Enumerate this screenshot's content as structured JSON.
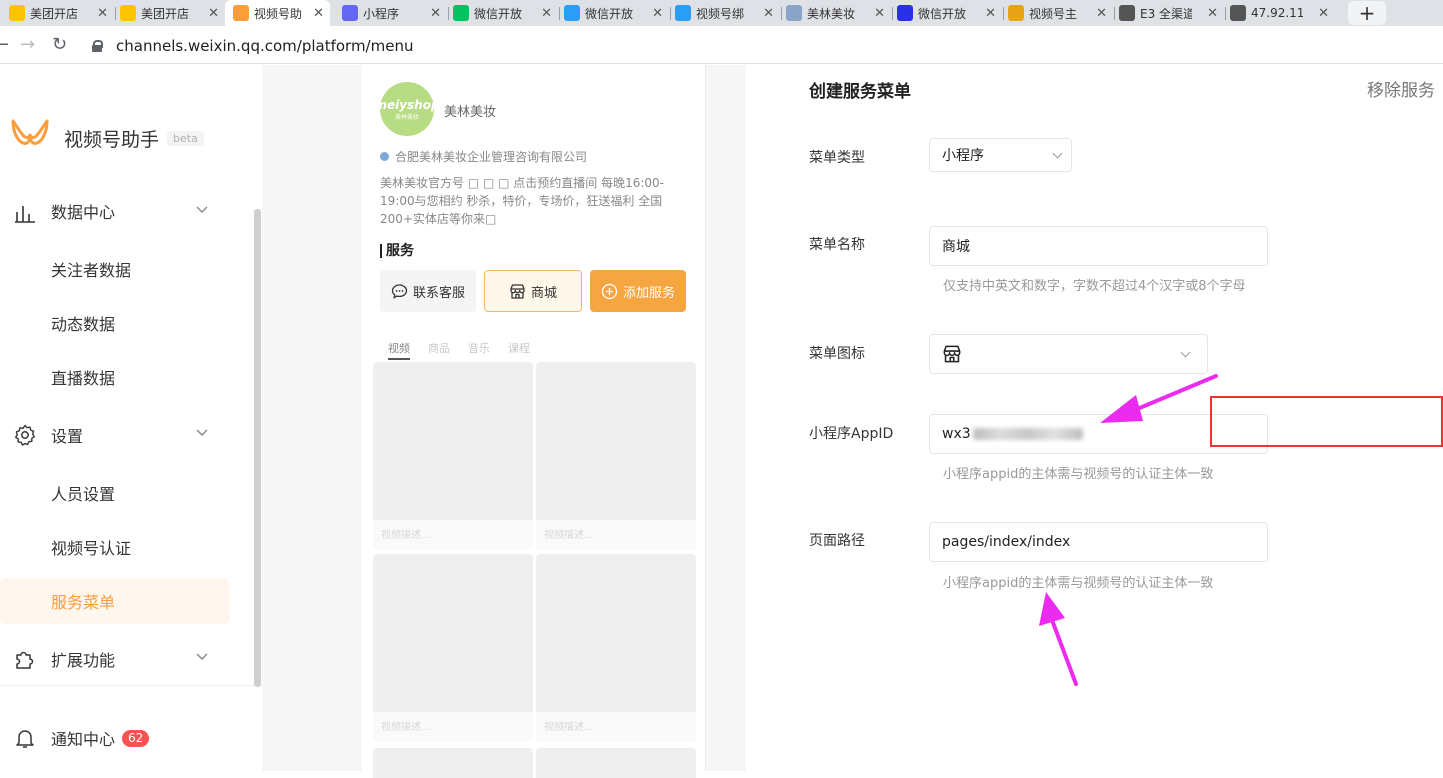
{
  "browser": {
    "tabs": [
      {
        "label": "美团开店",
        "icon": "meituan-icon",
        "color": "#ffc300"
      },
      {
        "label": "美团开店",
        "icon": "meituan-icon",
        "color": "#ffc300"
      },
      {
        "label": "视频号助",
        "icon": "channels-icon",
        "color": "#fa9d3b",
        "active": true
      },
      {
        "label": "小程序",
        "icon": "miniprogram-icon",
        "color": "#6467f0"
      },
      {
        "label": "微信开放",
        "icon": "wechat-icon",
        "color": "#07c160"
      },
      {
        "label": "微信开放",
        "icon": "grid-icon",
        "color": "#2a9df4"
      },
      {
        "label": "视频号绑",
        "icon": "grid-icon",
        "color": "#2a9df4"
      },
      {
        "label": "美林美妆",
        "icon": "doc-icon",
        "color": "#8aa4c8"
      },
      {
        "label": "微信开放",
        "icon": "baidu-icon",
        "color": "#2932e1"
      },
      {
        "label": "视频号主",
        "icon": "s-icon",
        "color": "#e8a317"
      },
      {
        "label": "E3 全渠道",
        "icon": "globe-icon",
        "color": "#555555"
      },
      {
        "label": "47.92.11",
        "icon": "globe-icon",
        "color": "#555555"
      }
    ],
    "url": "channels.weixin.qq.com/platform/menu"
  },
  "sidebar": {
    "brand": "视频号助手",
    "beta": "beta",
    "items": [
      {
        "label": "数据中心"
      },
      {
        "label": "关注者数据"
      },
      {
        "label": "动态数据"
      },
      {
        "label": "直播数据"
      },
      {
        "label": "设置"
      },
      {
        "label": "人员设置"
      },
      {
        "label": "视频号认证"
      },
      {
        "label": "服务菜单",
        "active": true
      },
      {
        "label": "扩展功能"
      },
      {
        "label": "通知中心"
      }
    ],
    "notify_count": "62",
    "accent": "#fa9d3b"
  },
  "preview": {
    "avatar_text": "meiyshop",
    "avatar_sub": "美林美妆",
    "account_name": "美林美妆",
    "company": "合肥美林美妆企业管理咨询有限公司",
    "bio": "美林美妆官方号 □ □ □ 点击预约直播间 每晚16:00-19:00与您相约 秒杀，特价，专场价，狂送福利 全国200+实体店等你来□",
    "services_title": "服务",
    "btn_cs": "联系客服",
    "btn_mall": "商城",
    "btn_add": "添加服务",
    "tabs": [
      "视频",
      "商品",
      "音乐",
      "课程"
    ],
    "thumb_caption": "视频描述..."
  },
  "form": {
    "title": "创建服务菜单",
    "remove": "移除服务",
    "menu_type_label": "菜单类型",
    "menu_type_value": "小程序",
    "menu_name_label": "菜单名称",
    "menu_name_value": "商城",
    "menu_name_hint": "仅支持中英文和数字，字数不超过4个汉字或8个字母",
    "menu_icon_label": "菜单图标",
    "appid_label": "小程序AppID",
    "appid_value": "wx3",
    "appid_hint": "小程序appid的主体需与视频号的认证主体一致",
    "path_label": "页面路径",
    "path_value": "pages/index/index",
    "path_hint": "小程序appid的主体需与视频号的认证主体一致"
  }
}
